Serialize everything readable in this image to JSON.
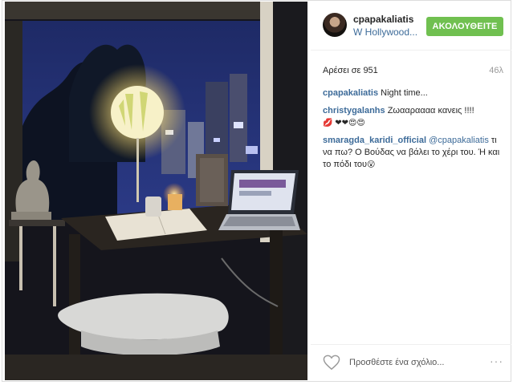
{
  "post": {
    "username": "cpapakaliatis",
    "location": "W Hollywood...",
    "follow_label": "ΑΚΟΛΟΥΘΕΙΤΕ",
    "likes": "Αρέσει σε 951",
    "time_ago": "46λ",
    "comments": [
      {
        "user": "cpapakaliatis",
        "text": " Night time..."
      },
      {
        "user": "christygalanhs",
        "text": " Ζωααραααα κανεις !!!! ",
        "emoji": "💋 ❤❤😍😍"
      },
      {
        "user": "smaragda_karidi_official",
        "mention": " @cpapakaliatis",
        "text": " τι να πω? Ο Βούδας να βάλει το χέρι του. Ή και το πόδι του",
        "emoji": "😮"
      }
    ],
    "comment_placeholder": "Προσθέστε ένα σχόλιο...",
    "more_label": "···"
  },
  "icons": {
    "heart": "heart-icon",
    "more": "more-options-icon"
  },
  "colors": {
    "follow_button": "#70c050",
    "link": "#3d6b99"
  }
}
